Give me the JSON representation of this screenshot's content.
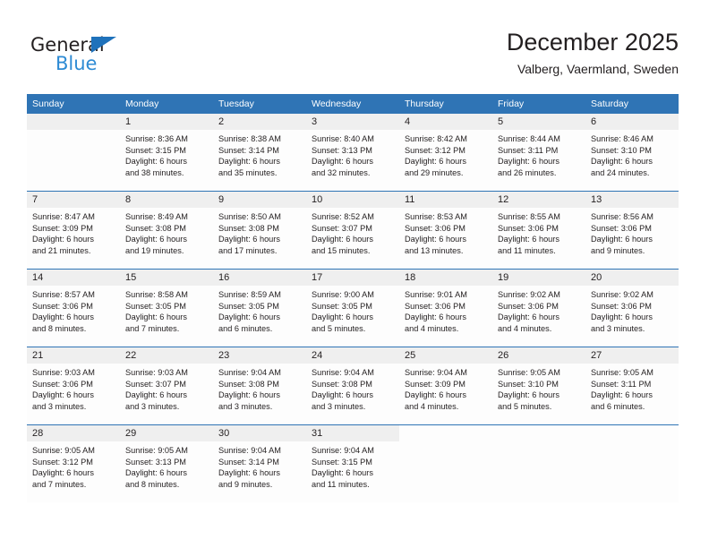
{
  "brand": {
    "name_top": "General",
    "name_bottom": "Blue",
    "triangle_color": "#1f72bb",
    "blue_color": "#2e8bd4"
  },
  "header": {
    "title": "December 2025",
    "subtitle": "Valberg, Vaermland, Sweden"
  },
  "theme": {
    "header_blue": "#2f74b5",
    "daynum_gray": "#efefef",
    "text": "#231f20"
  },
  "weekdays": [
    "Sunday",
    "Monday",
    "Tuesday",
    "Wednesday",
    "Thursday",
    "Friday",
    "Saturday"
  ],
  "weeks": [
    [
      {
        "day": ""
      },
      {
        "day": "1",
        "sunrise": "Sunrise: 8:36 AM",
        "sunset": "Sunset: 3:15 PM",
        "daylight1": "Daylight: 6 hours",
        "daylight2": "and 38 minutes."
      },
      {
        "day": "2",
        "sunrise": "Sunrise: 8:38 AM",
        "sunset": "Sunset: 3:14 PM",
        "daylight1": "Daylight: 6 hours",
        "daylight2": "and 35 minutes."
      },
      {
        "day": "3",
        "sunrise": "Sunrise: 8:40 AM",
        "sunset": "Sunset: 3:13 PM",
        "daylight1": "Daylight: 6 hours",
        "daylight2": "and 32 minutes."
      },
      {
        "day": "4",
        "sunrise": "Sunrise: 8:42 AM",
        "sunset": "Sunset: 3:12 PM",
        "daylight1": "Daylight: 6 hours",
        "daylight2": "and 29 minutes."
      },
      {
        "day": "5",
        "sunrise": "Sunrise: 8:44 AM",
        "sunset": "Sunset: 3:11 PM",
        "daylight1": "Daylight: 6 hours",
        "daylight2": "and 26 minutes."
      },
      {
        "day": "6",
        "sunrise": "Sunrise: 8:46 AM",
        "sunset": "Sunset: 3:10 PM",
        "daylight1": "Daylight: 6 hours",
        "daylight2": "and 24 minutes."
      }
    ],
    [
      {
        "day": "7",
        "sunrise": "Sunrise: 8:47 AM",
        "sunset": "Sunset: 3:09 PM",
        "daylight1": "Daylight: 6 hours",
        "daylight2": "and 21 minutes."
      },
      {
        "day": "8",
        "sunrise": "Sunrise: 8:49 AM",
        "sunset": "Sunset: 3:08 PM",
        "daylight1": "Daylight: 6 hours",
        "daylight2": "and 19 minutes."
      },
      {
        "day": "9",
        "sunrise": "Sunrise: 8:50 AM",
        "sunset": "Sunset: 3:08 PM",
        "daylight1": "Daylight: 6 hours",
        "daylight2": "and 17 minutes."
      },
      {
        "day": "10",
        "sunrise": "Sunrise: 8:52 AM",
        "sunset": "Sunset: 3:07 PM",
        "daylight1": "Daylight: 6 hours",
        "daylight2": "and 15 minutes."
      },
      {
        "day": "11",
        "sunrise": "Sunrise: 8:53 AM",
        "sunset": "Sunset: 3:06 PM",
        "daylight1": "Daylight: 6 hours",
        "daylight2": "and 13 minutes."
      },
      {
        "day": "12",
        "sunrise": "Sunrise: 8:55 AM",
        "sunset": "Sunset: 3:06 PM",
        "daylight1": "Daylight: 6 hours",
        "daylight2": "and 11 minutes."
      },
      {
        "day": "13",
        "sunrise": "Sunrise: 8:56 AM",
        "sunset": "Sunset: 3:06 PM",
        "daylight1": "Daylight: 6 hours",
        "daylight2": "and 9 minutes."
      }
    ],
    [
      {
        "day": "14",
        "sunrise": "Sunrise: 8:57 AM",
        "sunset": "Sunset: 3:06 PM",
        "daylight1": "Daylight: 6 hours",
        "daylight2": "and 8 minutes."
      },
      {
        "day": "15",
        "sunrise": "Sunrise: 8:58 AM",
        "sunset": "Sunset: 3:05 PM",
        "daylight1": "Daylight: 6 hours",
        "daylight2": "and 7 minutes."
      },
      {
        "day": "16",
        "sunrise": "Sunrise: 8:59 AM",
        "sunset": "Sunset: 3:05 PM",
        "daylight1": "Daylight: 6 hours",
        "daylight2": "and 6 minutes."
      },
      {
        "day": "17",
        "sunrise": "Sunrise: 9:00 AM",
        "sunset": "Sunset: 3:05 PM",
        "daylight1": "Daylight: 6 hours",
        "daylight2": "and 5 minutes."
      },
      {
        "day": "18",
        "sunrise": "Sunrise: 9:01 AM",
        "sunset": "Sunset: 3:06 PM",
        "daylight1": "Daylight: 6 hours",
        "daylight2": "and 4 minutes."
      },
      {
        "day": "19",
        "sunrise": "Sunrise: 9:02 AM",
        "sunset": "Sunset: 3:06 PM",
        "daylight1": "Daylight: 6 hours",
        "daylight2": "and 4 minutes."
      },
      {
        "day": "20",
        "sunrise": "Sunrise: 9:02 AM",
        "sunset": "Sunset: 3:06 PM",
        "daylight1": "Daylight: 6 hours",
        "daylight2": "and 3 minutes."
      }
    ],
    [
      {
        "day": "21",
        "sunrise": "Sunrise: 9:03 AM",
        "sunset": "Sunset: 3:06 PM",
        "daylight1": "Daylight: 6 hours",
        "daylight2": "and 3 minutes."
      },
      {
        "day": "22",
        "sunrise": "Sunrise: 9:03 AM",
        "sunset": "Sunset: 3:07 PM",
        "daylight1": "Daylight: 6 hours",
        "daylight2": "and 3 minutes."
      },
      {
        "day": "23",
        "sunrise": "Sunrise: 9:04 AM",
        "sunset": "Sunset: 3:08 PM",
        "daylight1": "Daylight: 6 hours",
        "daylight2": "and 3 minutes."
      },
      {
        "day": "24",
        "sunrise": "Sunrise: 9:04 AM",
        "sunset": "Sunset: 3:08 PM",
        "daylight1": "Daylight: 6 hours",
        "daylight2": "and 3 minutes."
      },
      {
        "day": "25",
        "sunrise": "Sunrise: 9:04 AM",
        "sunset": "Sunset: 3:09 PM",
        "daylight1": "Daylight: 6 hours",
        "daylight2": "and 4 minutes."
      },
      {
        "day": "26",
        "sunrise": "Sunrise: 9:05 AM",
        "sunset": "Sunset: 3:10 PM",
        "daylight1": "Daylight: 6 hours",
        "daylight2": "and 5 minutes."
      },
      {
        "day": "27",
        "sunrise": "Sunrise: 9:05 AM",
        "sunset": "Sunset: 3:11 PM",
        "daylight1": "Daylight: 6 hours",
        "daylight2": "and 6 minutes."
      }
    ],
    [
      {
        "day": "28",
        "sunrise": "Sunrise: 9:05 AM",
        "sunset": "Sunset: 3:12 PM",
        "daylight1": "Daylight: 6 hours",
        "daylight2": "and 7 minutes."
      },
      {
        "day": "29",
        "sunrise": "Sunrise: 9:05 AM",
        "sunset": "Sunset: 3:13 PM",
        "daylight1": "Daylight: 6 hours",
        "daylight2": "and 8 minutes."
      },
      {
        "day": "30",
        "sunrise": "Sunrise: 9:04 AM",
        "sunset": "Sunset: 3:14 PM",
        "daylight1": "Daylight: 6 hours",
        "daylight2": "and 9 minutes."
      },
      {
        "day": "31",
        "sunrise": "Sunrise: 9:04 AM",
        "sunset": "Sunset: 3:15 PM",
        "daylight1": "Daylight: 6 hours",
        "daylight2": "and 11 minutes."
      },
      {
        "day": ""
      },
      {
        "day": ""
      },
      {
        "day": ""
      }
    ]
  ]
}
